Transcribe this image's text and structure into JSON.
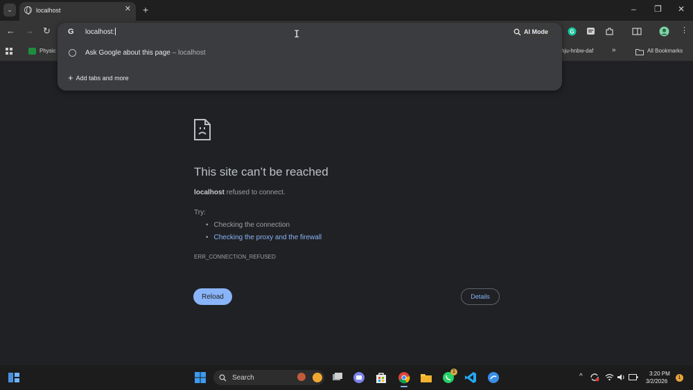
{
  "browser": {
    "tab": {
      "title": "localhost"
    },
    "omnibox": {
      "value": "localhost:",
      "suggestion_ask": "Ask Google about this page",
      "suggestion_ask_sub": "localhost",
      "add_tabs": "Add tabs and more"
    },
    "toolbar": {
      "ai_mode": "AI Mode"
    },
    "bookmarks": {
      "item1": "Physic",
      "item2": "hju-hnbw-daf",
      "overflow": "»",
      "all_bookmarks": "All Bookmarks"
    }
  },
  "error_page": {
    "title": "This site can’t be reached",
    "host": "localhost",
    "desc_rest": " refused to connect.",
    "try_label": "Try:",
    "suggestions": [
      "Checking the connection",
      "Checking the proxy and the firewall"
    ],
    "code": "ERR_CONNECTION_REFUSED",
    "reload_label": "Reload",
    "details_label": "Details"
  },
  "taskbar": {
    "search_label": "Search",
    "time": "3:20 PM",
    "date": "3/2/2026",
    "whatsapp_badge": "1",
    "notification_count": "1"
  },
  "colors": {
    "page_bg": "#202124",
    "chrome_bar": "#353535",
    "link": "#8ab4f8",
    "button_primary": "#8ab4f8"
  }
}
